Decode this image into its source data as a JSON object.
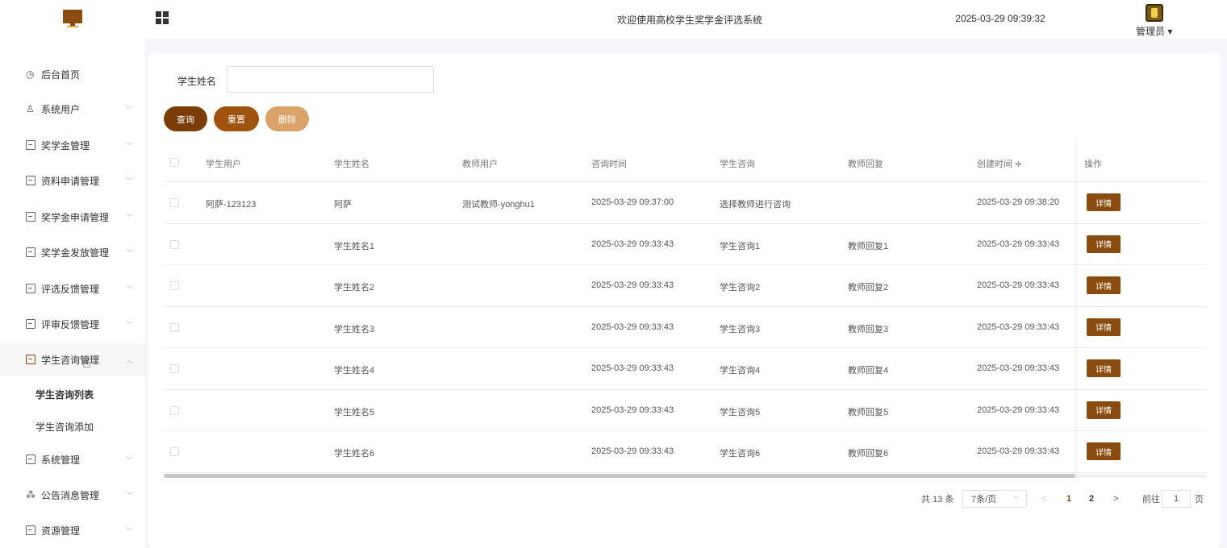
{
  "header": {
    "title": "欢迎使用高校学生奖学金评选系统",
    "datetime": "2025-03-29 09:39:32",
    "user": "管理员"
  },
  "sidebar": {
    "items": [
      {
        "label": "后台首页",
        "icon": "clock-icon"
      },
      {
        "label": "系统用户",
        "icon": "user-icon"
      },
      {
        "label": "奖学金管理",
        "icon": "box-icon"
      },
      {
        "label": "资料申请管理",
        "icon": "box-icon"
      },
      {
        "label": "奖学金申请管理",
        "icon": "box-icon"
      },
      {
        "label": "奖学金发放管理",
        "icon": "box-icon"
      },
      {
        "label": "评选反馈管理",
        "icon": "box-icon"
      },
      {
        "label": "评审反馈管理",
        "icon": "box-icon"
      },
      {
        "label": "学生咨询管理",
        "icon": "box-icon"
      },
      {
        "label": "系统管理",
        "icon": "folder-icon"
      },
      {
        "label": "公告消息管理",
        "icon": "sparkle-icon"
      },
      {
        "label": "资源管理",
        "icon": "chat-icon"
      }
    ],
    "sub_items": [
      {
        "label": "学生咨询列表"
      },
      {
        "label": "学生咨询添加"
      }
    ]
  },
  "search": {
    "label": "学生姓名",
    "value": "",
    "placeholder": ""
  },
  "buttons": {
    "query": "查询",
    "reset": "重置",
    "delete": "删除"
  },
  "table": {
    "columns": [
      "学生用户",
      "学生姓名",
      "教师用户",
      "咨询时间",
      "学生咨询",
      "教师回复",
      "创建时间 ≑",
      "操作"
    ],
    "rows": [
      {
        "student_user": "阿萨-123123",
        "student_name": "阿萨",
        "teacher_user": "测试教师-yonghu1",
        "consult_time": "2025-03-29 09:37:00",
        "consult": "选择教师进行咨询",
        "reply": "",
        "created": "2025-03-29 09:38:20",
        "action": "详情"
      },
      {
        "student_user": "",
        "student_name": "学生姓名1",
        "teacher_user": "",
        "consult_time": "2025-03-29 09:33:43",
        "consult": "学生咨询1",
        "reply": "教师回复1",
        "created": "2025-03-29 09:33:43",
        "action": "详情"
      },
      {
        "student_user": "",
        "student_name": "学生姓名2",
        "teacher_user": "",
        "consult_time": "2025-03-29 09:33:43",
        "consult": "学生咨询2",
        "reply": "教师回复2",
        "created": "2025-03-29 09:33:43",
        "action": "详情"
      },
      {
        "student_user": "",
        "student_name": "学生姓名3",
        "teacher_user": "",
        "consult_time": "2025-03-29 09:33:43",
        "consult": "学生咨询3",
        "reply": "教师回复3",
        "created": "2025-03-29 09:33:43",
        "action": "详情"
      },
      {
        "student_user": "",
        "student_name": "学生姓名4",
        "teacher_user": "",
        "consult_time": "2025-03-29 09:33:43",
        "consult": "学生咨询4",
        "reply": "教师回复4",
        "created": "2025-03-29 09:33:43",
        "action": "详情"
      },
      {
        "student_user": "",
        "student_name": "学生姓名5",
        "teacher_user": "",
        "consult_time": "2025-03-29 09:33:43",
        "consult": "学生咨询5",
        "reply": "教师回复5",
        "created": "2025-03-29 09:33:43",
        "action": "详情"
      },
      {
        "student_user": "",
        "student_name": "学生姓名6",
        "teacher_user": "",
        "consult_time": "2025-03-29 09:33:43",
        "consult": "学生咨询6",
        "reply": "教师回复6",
        "created": "2025-03-29 09:33:43",
        "action": "详情"
      }
    ]
  },
  "pagination": {
    "total": "共 13 条",
    "page_size": "7条/页",
    "prev": "<",
    "page1": "1",
    "page2": "2",
    "next": ">",
    "goto_label": "前往",
    "goto_value": "1",
    "page_suffix": "页"
  },
  "colors": {
    "accent": "#8a4b0f",
    "query": "#7a3d07",
    "reset": "#a0520f",
    "delete": "#dba26a"
  }
}
